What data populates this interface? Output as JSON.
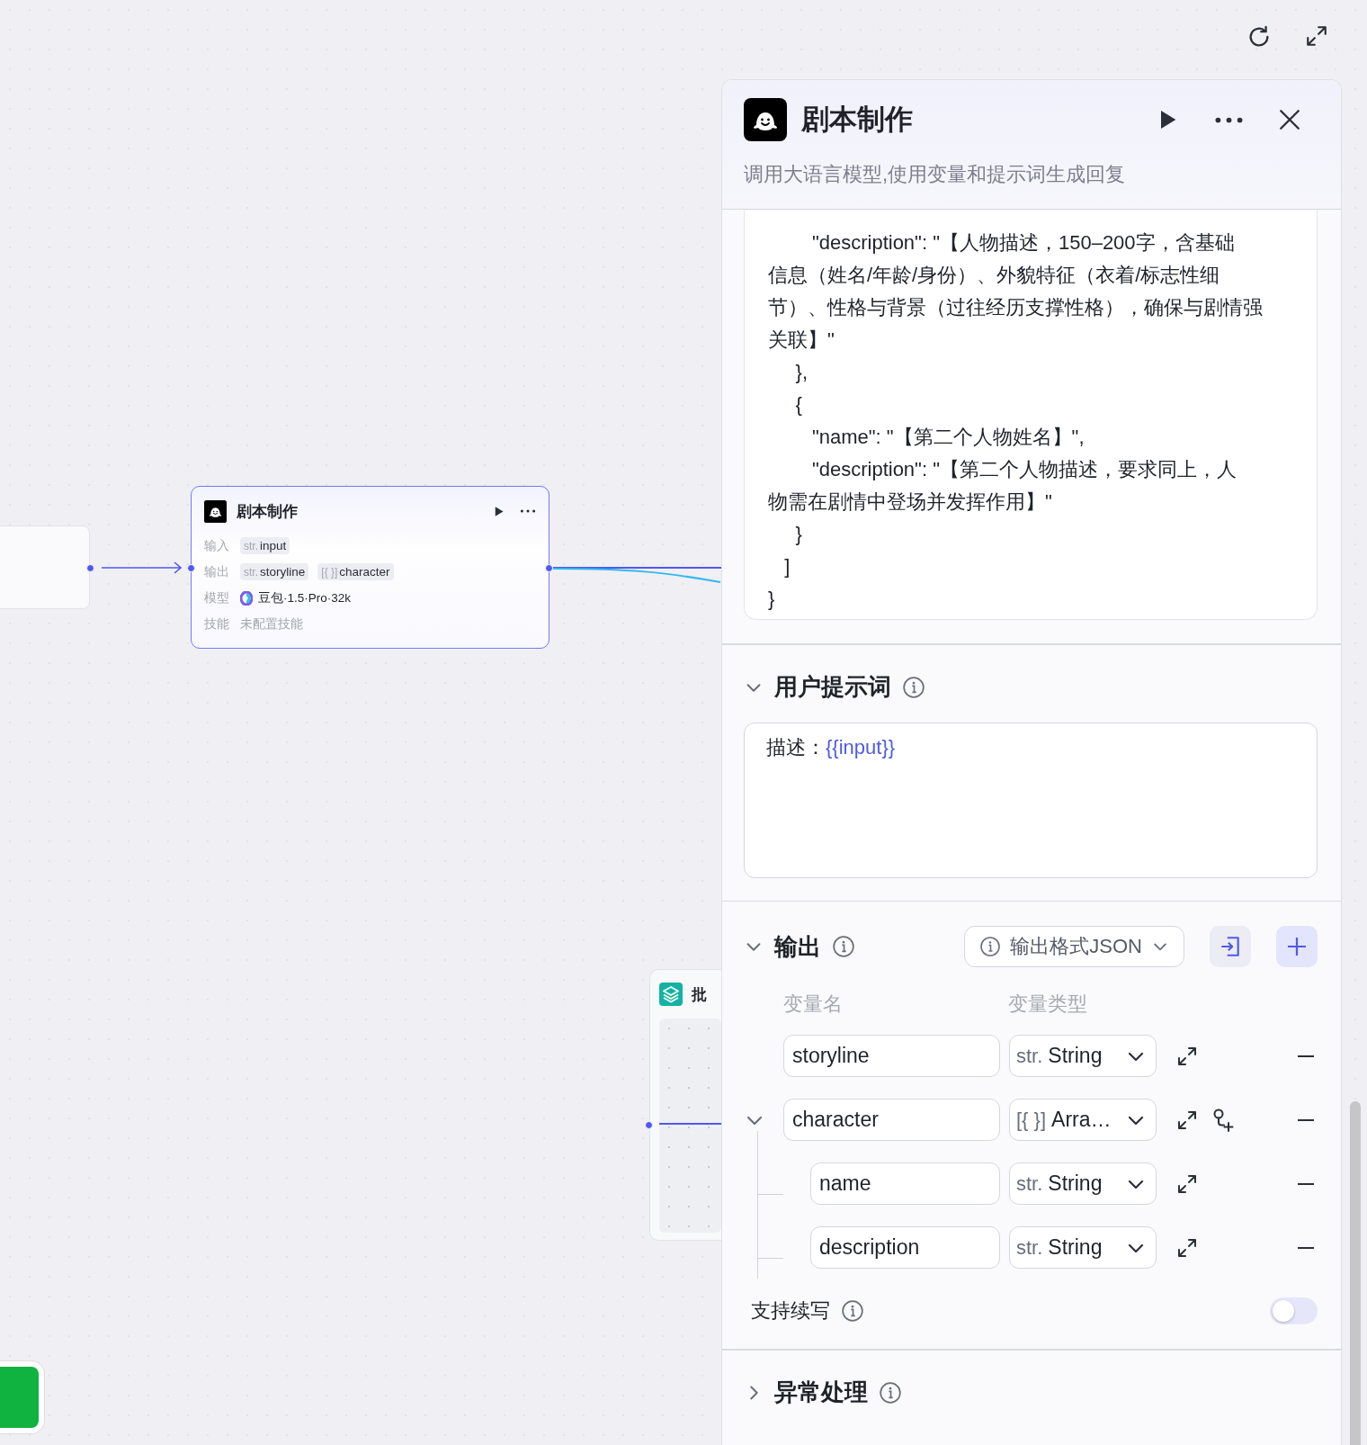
{
  "canvas": {
    "nodes": [
      {
        "kind": "llm",
        "title": "剧本制作",
        "rows": [
          {
            "label": "输入",
            "kind": "tags",
            "tags": [
              {
                "type": "str.",
                "name": "input"
              }
            ]
          },
          {
            "label": "输出",
            "kind": "tags",
            "tags": [
              {
                "type": "str.",
                "name": "storyline"
              },
              {
                "type": "[{ }]",
                "name": "character"
              }
            ]
          },
          {
            "label": "模型",
            "kind": "model",
            "value": "豆包·1.5·Pro·32k"
          },
          {
            "label": "技能",
            "kind": "empty",
            "value": "未配置技能"
          }
        ]
      },
      {
        "kind": "batch",
        "title": "批"
      }
    ]
  },
  "panel": {
    "title": "剧本制作",
    "description": "调用大语言模型,使用变量和提示词生成回复",
    "system_prompt_lines": [
      "        \"description\": \"【人物描述，150–200字，含基础",
      "信息（姓名/年龄/身份）、外貌特征（衣着/标志性细",
      "节）、性格与背景（过往经历支撑性格），确保与剧情强",
      "关联】\"",
      "     },",
      "     {",
      "        \"name\": \"【第二个人物姓名】\",",
      "        \"description\": \"【第二个人物描述，要求同上，人",
      "物需在剧情中登场并发挥作用】\"",
      "     }",
      "   ]",
      "}"
    ],
    "user_prompt": {
      "title": "用户提示词",
      "expanded": true,
      "content": [
        {
          "kind": "text",
          "text": "描述："
        },
        {
          "kind": "variable",
          "text": "{{input}}"
        }
      ]
    },
    "output": {
      "title": "输出",
      "expanded": true,
      "format_button": "输出格式JSON",
      "columns": [
        "变量名",
        "变量类型"
      ],
      "variables": [
        {
          "name": "storyline",
          "type_prefix": "str.",
          "type": "String"
        },
        {
          "name": "character",
          "type_prefix": "[{ }]",
          "type": "Arra…",
          "expanded": true,
          "children": [
            {
              "name": "name",
              "type_prefix": "str.",
              "type": "String"
            },
            {
              "name": "description",
              "type_prefix": "str.",
              "type": "String"
            }
          ]
        }
      ]
    },
    "continue_writing": {
      "label": "支持续写",
      "on": false
    },
    "error_handling": {
      "title": "异常处理",
      "expanded": false
    }
  }
}
